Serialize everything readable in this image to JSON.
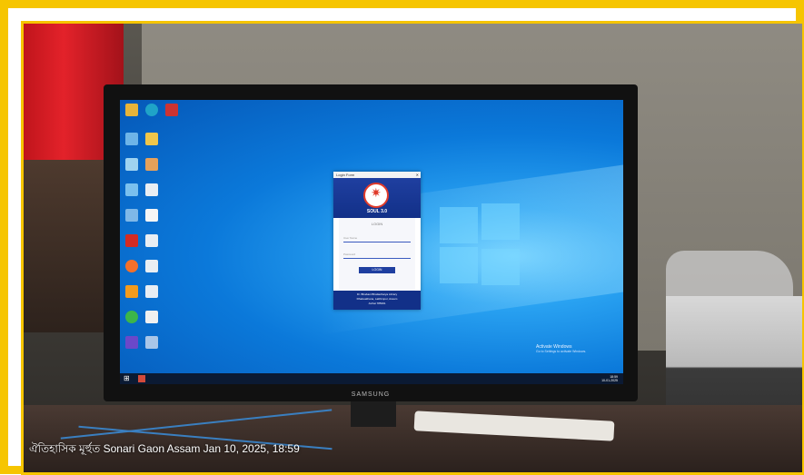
{
  "photo": {
    "monitor_brand": "SAMSUNG",
    "caption": "ঐতিহাসিক মূর্হুত Sonari Gaon Assam Jan 10, 2025, 18:59",
    "frame_color": "#f6c500"
  },
  "screen": {
    "login_window": {
      "title": "Login Form",
      "app_name": "SOUL 3.0",
      "form_title": "LOGIN",
      "user_placeholder": "User Name",
      "password_placeholder": "Password",
      "button_label": "LOGIN",
      "footer_lines": [
        "Dr. Bhabani Bhattacharya Library",
        "Dhakuakhana, Lakhimpur, Assam",
        "Jorhat 785001"
      ]
    },
    "activate_windows": {
      "title": "Activate Windows",
      "subtitle": "Go to Settings to activate Windows."
    },
    "taskbar": {
      "time": "18:59",
      "date": "10-01-2025"
    }
  }
}
